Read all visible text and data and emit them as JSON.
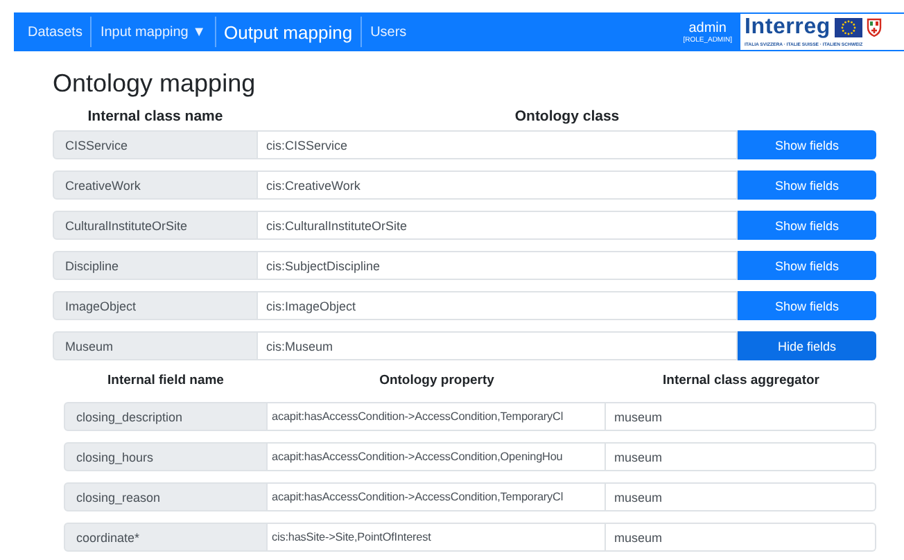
{
  "navbar": {
    "items": [
      {
        "label": "Datasets",
        "selected": false
      },
      {
        "label": "Input mapping",
        "selected": false,
        "caret": "▼"
      },
      {
        "label": "Output mapping",
        "selected": true
      },
      {
        "label": "Users",
        "selected": false
      }
    ],
    "user": {
      "name": "admin",
      "role": "[ROLE_ADMIN]"
    },
    "logo": {
      "wordmark": "Interreg",
      "subline": "ITALIA SVIZZERA · ITALIE SUISSE · ITALIEN SCHWEIZ"
    }
  },
  "page_title": "Ontology mapping",
  "class_table": {
    "columns": [
      "Internal class name",
      "Ontology class"
    ],
    "rows": [
      {
        "name": "CISService",
        "ontology_class": "cis:CISService",
        "button": "Show fields",
        "expanded": false
      },
      {
        "name": "CreativeWork",
        "ontology_class": "cis:CreativeWork",
        "button": "Show fields",
        "expanded": false
      },
      {
        "name": "CulturalInstituteOrSite",
        "ontology_class": "cis:CulturalInstituteOrSite",
        "button": "Show fields",
        "expanded": false
      },
      {
        "name": "Discipline",
        "ontology_class": "cis:SubjectDiscipline",
        "button": "Show fields",
        "expanded": false
      },
      {
        "name": "ImageObject",
        "ontology_class": "cis:ImageObject",
        "button": "Show fields",
        "expanded": false
      },
      {
        "name": "Museum",
        "ontology_class": "cis:Museum",
        "button": "Hide fields",
        "expanded": true
      }
    ]
  },
  "field_table": {
    "columns": [
      "Internal field name",
      "Ontology property",
      "Internal class aggregator"
    ],
    "rows": [
      {
        "name": "closing_description",
        "property": "acapit:hasAccessCondition->AccessCondition,TemporaryCl",
        "aggregator": "museum"
      },
      {
        "name": "closing_hours",
        "property": "acapit:hasAccessCondition->AccessCondition,OpeningHou",
        "aggregator": "museum"
      },
      {
        "name": "closing_reason",
        "property": "acapit:hasAccessCondition->AccessCondition,TemporaryCl",
        "aggregator": "museum"
      },
      {
        "name": "coordinate*",
        "property": "cis:hasSite->Site,PointOfInterest",
        "aggregator": "museum"
      }
    ]
  }
}
